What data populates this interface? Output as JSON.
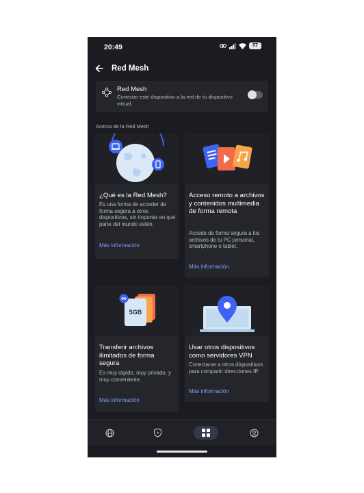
{
  "status_bar": {
    "time": "20:49",
    "battery": "57"
  },
  "app_bar": {
    "title": "Red Mesh"
  },
  "mesh_toggle": {
    "title": "Red Mesh",
    "description": "Conectar este dispositivo a la red de tu dispositivo virtual.",
    "enabled": false
  },
  "section_title": "Acerca de la Red Mesh",
  "cards": [
    {
      "title": "¿Qué es la Red Mesh?",
      "description": "Es una forma de acceder de forma segura a otros dispositivos, sin importar en qué parte del mundo estén.",
      "link": "Más información"
    },
    {
      "title": "Acceso remoto a archivos y contenidos multimedia de forma remota",
      "description": "Accede de forma segura a los archivos de tu PC personal, smartphone o tablet.",
      "link": "Más información"
    },
    {
      "title": "Transferir archivos ilimitados de forma segura",
      "description": "Es muy rápido, muy privado, y muy conveniente.",
      "link": "Más información",
      "badge": "5GB"
    },
    {
      "title": "Usar otros dispositivos como servidores VPN",
      "description": "Conectarse a otros dispositivos para compartir direcciones IP.",
      "link": "Más información"
    }
  ],
  "bottom_nav": [
    {
      "icon": "globe-icon",
      "active": false
    },
    {
      "icon": "shield-bolt-icon",
      "active": false
    },
    {
      "icon": "grid-icon",
      "active": true
    },
    {
      "icon": "profile-icon",
      "active": false
    }
  ],
  "colors": {
    "background": "#1b1c21",
    "card": "#24262c",
    "link": "#7ea1ff",
    "accent_blue": "#3d63f2"
  }
}
